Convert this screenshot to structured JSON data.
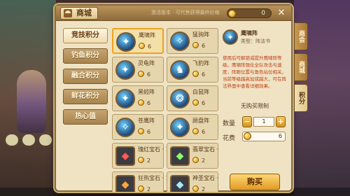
{
  "window": {
    "title": "商城",
    "tip": "激活版本 · 可代售获得最终价格",
    "coins": "0",
    "close_label": "✕"
  },
  "categories": [
    {
      "label": "竞技积分",
      "active": true
    },
    {
      "label": "钓鱼积分",
      "active": false
    },
    {
      "label": "融合积分",
      "active": false
    },
    {
      "label": "鲜花积分",
      "active": false
    },
    {
      "label": "热心值",
      "active": false
    }
  ],
  "items": [
    {
      "name": "鹰啸阵",
      "price": "6",
      "type": "formation",
      "glyph": "✦",
      "selected": true
    },
    {
      "name": "猛驹阵",
      "price": "6",
      "type": "formation",
      "glyph": "✧",
      "selected": false
    },
    {
      "name": "灵龟阵",
      "price": "6",
      "type": "formation",
      "glyph": "✦",
      "selected": false
    },
    {
      "name": "飞豹阵",
      "price": "6",
      "type": "formation",
      "glyph": "♞",
      "selected": false
    },
    {
      "name": "黑蚓阵",
      "price": "6",
      "type": "formation",
      "glyph": "✦",
      "selected": false
    },
    {
      "name": "白鼠阵",
      "price": "6",
      "type": "formation",
      "glyph": "❂",
      "selected": false
    },
    {
      "name": "苍鹰阵",
      "price": "6",
      "type": "formation",
      "glyph": "✧",
      "selected": false
    },
    {
      "name": "顾盘阵",
      "price": "6",
      "type": "formation",
      "glyph": "✦",
      "selected": false
    },
    {
      "name": "瑰红宝石 · 1",
      "price": "2",
      "type": "gem",
      "color": "gem-red",
      "glyph": "◆",
      "selected": false
    },
    {
      "name": "翡翠宝石 · 1",
      "price": "2",
      "type": "gem",
      "color": "gem-green",
      "glyph": "◆",
      "selected": false
    },
    {
      "name": "狂热宝石 · 1",
      "price": "2",
      "type": "gem",
      "color": "gem-orange",
      "glyph": "◆",
      "selected": false
    },
    {
      "name": "神圣宝石 · 1",
      "price": "2",
      "type": "gem",
      "color": "gem-blue",
      "glyph": "◆",
      "selected": false
    }
  ],
  "detail": {
    "name": "鹰啸阵",
    "type": "类型：阵法书",
    "description": "使用后可解锁或提升鹰啸阵等级。鹰啸阵强化全队攻击与速度，阵眼位置与角色站位相关，当前等级越高加成越大，可在阵法界面中查看详细效果。",
    "limit": "无购买限制",
    "qty_label": "数量",
    "qty_minus": "−",
    "qty_plus": "+",
    "qty_value": "1",
    "cost_label": "花费",
    "cost_value": "6",
    "buy_label": "购买"
  },
  "side_tabs": [
    {
      "label": "商会",
      "active": false
    },
    {
      "label": "商城",
      "active": false
    },
    {
      "label": "积分",
      "active": true
    }
  ]
}
